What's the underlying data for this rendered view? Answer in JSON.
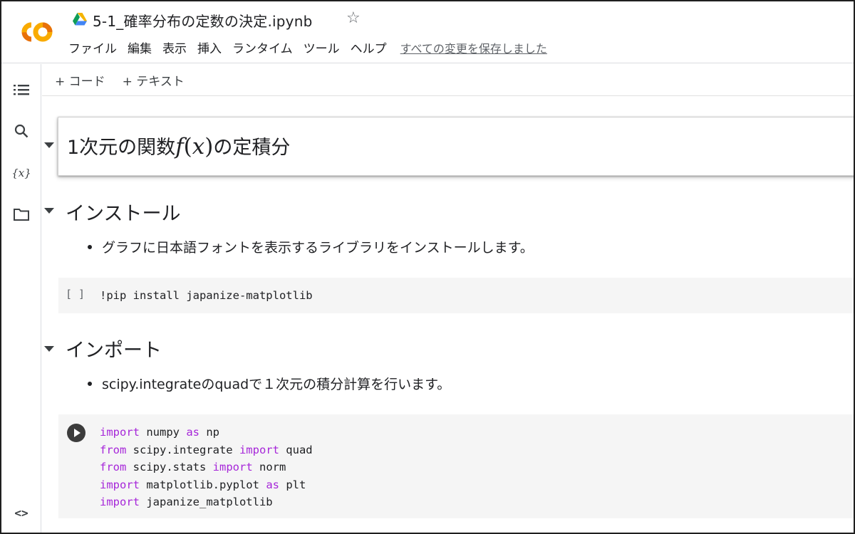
{
  "header": {
    "logo": "CO",
    "title": "5-1_確率分布の定数の決定.ipynb",
    "star_icon": "☆",
    "menu": [
      "ファイル",
      "編集",
      "表示",
      "挿入",
      "ランタイム",
      "ツール",
      "ヘルプ"
    ],
    "save_status": "すべての変更を保存しました"
  },
  "rail": {
    "icons": [
      "list-icon",
      "search-icon",
      "variables-icon",
      "folder-icon",
      "code-icon"
    ],
    "var_label": "{x}",
    "code_label": "<>"
  },
  "toolbar": {
    "add_code": "+ コード",
    "add_text": "+ テキスト"
  },
  "sections": {
    "h1": {
      "prefix": "1次元の関数",
      "math_f": "f",
      "math_open": "(",
      "math_x": "x",
      "math_close": ")",
      "suffix": "の定積分"
    },
    "install": {
      "heading": "インストール",
      "bullet": "グラフに日本語フォントを表示するライブラリをインストールします。",
      "cell_status": "[ ]",
      "code": "!pip install japanize-matplotlib"
    },
    "import": {
      "heading": "インポート",
      "bullet": "scipy.integrateのquadで１次元の積分計算を行います。",
      "code_lines": [
        {
          "kw1": "import",
          "t1": " numpy ",
          "kw2": "as",
          "t2": " np"
        },
        {
          "kw1": "from",
          "t1": " scipy.integrate ",
          "kw2": "import",
          "t2": " quad"
        },
        {
          "kw1": "from",
          "t1": " scipy.stats ",
          "kw2": "import",
          "t2": " norm"
        },
        {
          "kw1": "import",
          "t1": " matplotlib.pyplot ",
          "kw2": "as",
          "t2": " plt"
        },
        {
          "kw1": "import",
          "t1": " japanize_matplotlib",
          "kw2": "",
          "t2": ""
        }
      ]
    }
  },
  "colors": {
    "keyword": "#a626d9",
    "logo_orange": "#f9ab00",
    "drive_green": "#0f9d58",
    "drive_blue": "#4285f4",
    "drive_yellow": "#f4b400"
  }
}
